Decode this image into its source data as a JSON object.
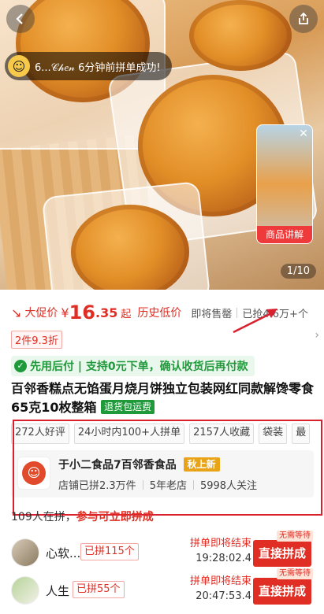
{
  "hero": {
    "group_toast": "6...𝒞𝒽𝑒𝓃 6分钟前拼单成功!",
    "live_label": "商品讲解",
    "image_counter": "1/10"
  },
  "price": {
    "promo_label": "大促价",
    "currency": "¥",
    "integer": "16",
    "decimal": ".35",
    "suffix": "起",
    "history_label": "历史低价",
    "soon_soldout": "即将售罄",
    "sold_count": "已抢4.6万+个",
    "multi_buy": "2件9.3折"
  },
  "pay_later": "先用后付 | 支持0元下单，确认收货后再付款",
  "title": {
    "text": "百邻香糕点无馅蛋月烧月饼独立包装网红同款解馋零食65克10枚整箱",
    "badge": "退货包运费"
  },
  "chips": [
    "272人好评",
    "24小时内100+人拼单",
    "2157人收藏",
    "袋装",
    "最"
  ],
  "store": {
    "name": "于小二食品7百邻香食品",
    "badge": "秋上新",
    "sales": "店铺已拼2.3万件",
    "age": "5年老店",
    "followers": "5998人关注"
  },
  "join": {
    "count_text": "109人在拼，",
    "cta_text": "参与可立即拼成"
  },
  "groups": [
    {
      "name": "心软...",
      "count": "已拼115个",
      "end_label": "拼单即将结束",
      "time": "19:28:02.4",
      "button": "直接拼成",
      "tag": "无需等待"
    },
    {
      "name": "人生",
      "count": "已拼55个",
      "end_label": "拼单即将结束",
      "time": "20:47:53.4",
      "button": "直接拼成",
      "tag": "无需等待"
    }
  ],
  "colors": {
    "accent_red": "#e02e24",
    "pay_green": "#1f9a3b",
    "annotation_red": "#d8202f"
  },
  "icons": {
    "back": "chevron-left-icon",
    "share": "share-icon",
    "close": "close-icon",
    "price_trend": "trend-down-icon",
    "chevron": "chevron-right-icon"
  }
}
